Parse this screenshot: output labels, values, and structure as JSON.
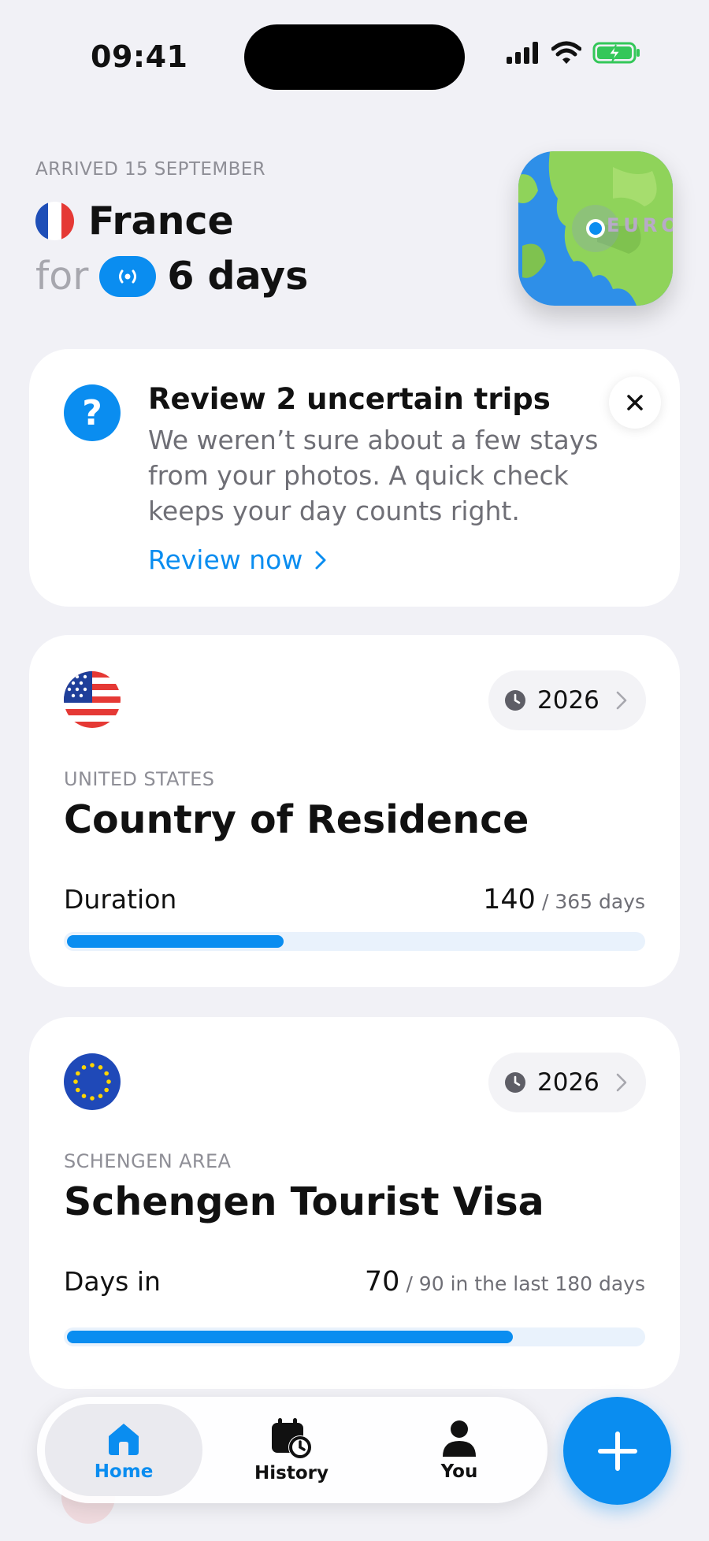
{
  "status_bar": {
    "time": "09:41"
  },
  "location": {
    "arrived": "ARRIVED 15 SEPTEMBER",
    "country": "France",
    "for_label": "for",
    "days": "6 days",
    "map_label": "EURO"
  },
  "review": {
    "title": "Review 2 uncertain trips",
    "body": "We weren’t sure about a few stays from your photos. A quick check keeps your day counts right.",
    "link": "Review now",
    "icon": "question-icon"
  },
  "residence": {
    "year": "2026",
    "region": "UNITED STATES",
    "title": "Country of Residence",
    "metric_label": "Duration",
    "value": "140",
    "total": "/ 365 days",
    "progress": 0.3836
  },
  "visa": {
    "year": "2026",
    "region": "SCHENGEN AREA",
    "title": "Schengen Tourist Visa",
    "metric_label": "Days in",
    "value": "70",
    "total": "/ 90 in the last 180 days",
    "progress": 0.7778
  },
  "tabs": [
    {
      "label": "Home",
      "icon": "home-icon",
      "active": true
    },
    {
      "label": "History",
      "icon": "calendar-clock-icon",
      "active": false
    },
    {
      "label": "You",
      "icon": "person-icon",
      "active": false
    }
  ],
  "colors": {
    "accent": "#0a8df0",
    "background": "#f1f1f6"
  }
}
